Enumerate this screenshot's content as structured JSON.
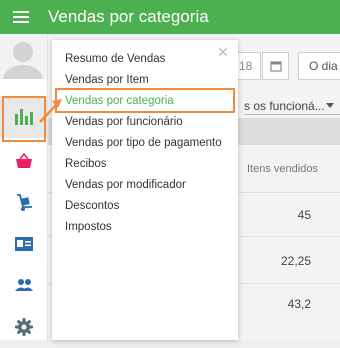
{
  "appbar": {
    "title": "Vendas por categoria"
  },
  "main": {
    "date_day_label": "18",
    "date_range_label": "O dia to",
    "employee_select": "s os funcioná...",
    "table": {
      "header": "Itens vendidos",
      "values": [
        "45",
        "22,25",
        "43,2"
      ]
    }
  },
  "menu": {
    "items": [
      "Resumo de Vendas",
      "Vendas por Item",
      "Vendas por categoria",
      "Vendas por funcionário",
      "Vendas por tipo de pagamento",
      "Recibos",
      "Vendas por modificador",
      "Descontos",
      "Impostos"
    ],
    "selected_index": 2
  },
  "colors": {
    "brand": "#4caf50",
    "accent_outline": "#f08a3c",
    "rail_icon": "#2b6cb0",
    "basket_icon": "#e91e63",
    "settings_icon": "#546e7a"
  },
  "icons": {
    "menu": "hamburger-icon",
    "reports": "bar-chart-icon",
    "items": "basket-icon",
    "inventory": "dolly-icon",
    "employees": "id-card-icon",
    "customers": "people-icon",
    "settings": "gear-icon"
  }
}
